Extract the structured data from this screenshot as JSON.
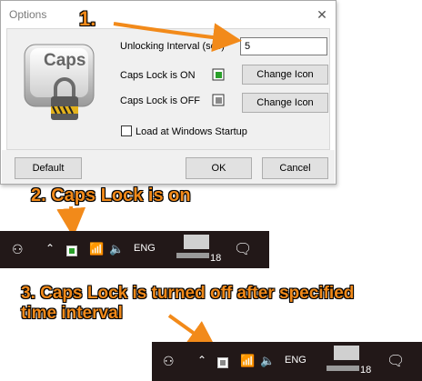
{
  "dialog": {
    "title": "Options",
    "close_glyph": "✕",
    "logo_text": "Caps",
    "unlock_label": "Unlocking Interval (sec)",
    "unlock_value": "5",
    "caps_on_label": "Caps Lock is ON",
    "caps_off_label": "Caps Lock is OFF",
    "change_icon_label": "Change Icon",
    "startup_label": "Load at Windows Startup",
    "default_label": "Default",
    "ok_label": "OK",
    "cancel_label": "Cancel"
  },
  "annotations": {
    "step1": "1.",
    "step2": "2. Caps Lock is on",
    "step3_line1": "3. Caps Lock is turned off after specified",
    "step3_line2": "time interval"
  },
  "taskbar1": {
    "lang": "ENG",
    "clock": "18"
  },
  "taskbar2": {
    "lang": "ENG",
    "clock": "18"
  },
  "colors": {
    "annotation": "#f28a1a",
    "taskbar": "#221818"
  }
}
